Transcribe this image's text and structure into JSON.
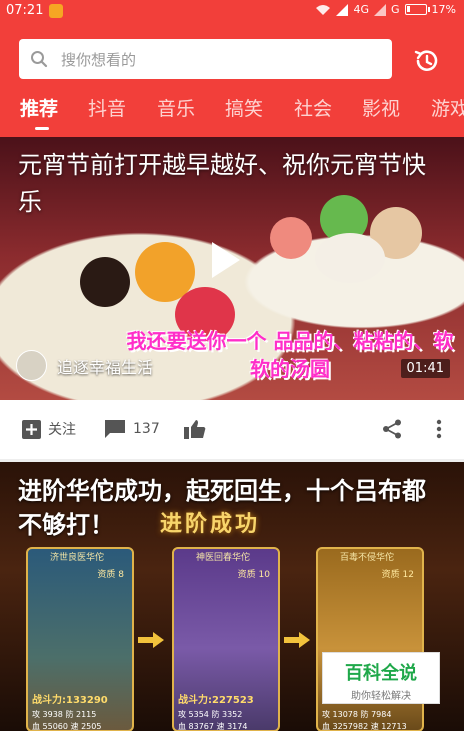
{
  "status_bar": {
    "time": "07:21",
    "network": "4G",
    "carrier_signal": "G",
    "battery": "17%",
    "battery_level": 0.17
  },
  "search": {
    "placeholder": "搜你想看的"
  },
  "tabs": [
    {
      "label": "推荐",
      "active": true
    },
    {
      "label": "抖音"
    },
    {
      "label": "音乐"
    },
    {
      "label": "搞笑"
    },
    {
      "label": "社会"
    },
    {
      "label": "影视"
    },
    {
      "label": "游戏"
    }
  ],
  "feed": [
    {
      "title": "元宵节前打开越早越好、祝你元宵节快乐",
      "caption": "我还要送你一个 品品的、粘粘的、软软的汤圆",
      "author": "追逐幸福生活",
      "duration": "01:41",
      "follow_label": "关注",
      "comment_count": "137"
    },
    {
      "title": "进阶华佗成功，起死回生，十个吕布都不够打！",
      "banner": "进阶成功",
      "cards": [
        {
          "name": "济世良医华佗",
          "quality": "资质 8",
          "power": "战斗力:133290",
          "stats": [
            "攻 3938  防 2115",
            "血 55060  速 2505"
          ]
        },
        {
          "name": "神医回春华佗",
          "quality": "资质 10",
          "power": "战斗力:227523",
          "stats": [
            "攻 5354  防 3352",
            "血 83767  速 3174"
          ]
        },
        {
          "name": "百毒不侵华佗",
          "quality": "资质 12",
          "power": "",
          "stats": [
            "攻 13078  防 7984",
            "血 3257982  速 12713"
          ]
        }
      ]
    }
  ],
  "watermark": {
    "title": "百科全说",
    "subtitle": "助你轻松解决"
  },
  "colors": {
    "brand": "#f23f3a",
    "watermark_green": "#1fa84a"
  }
}
